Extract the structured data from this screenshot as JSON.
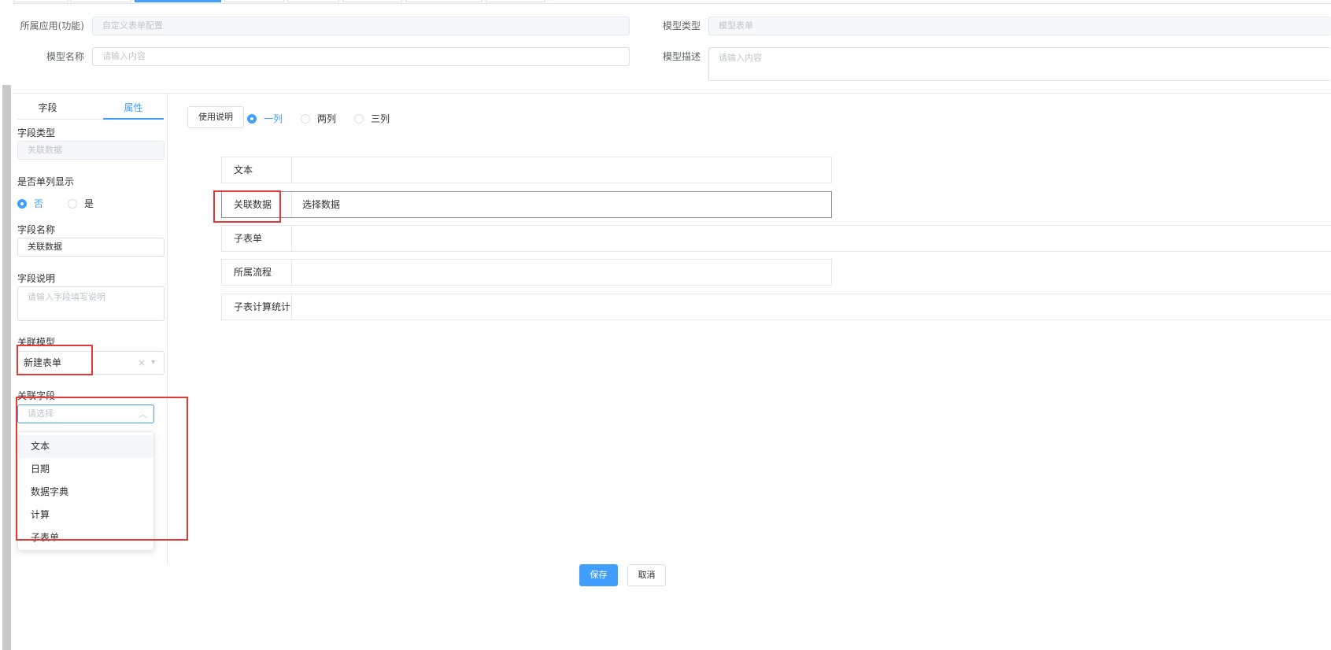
{
  "header": {
    "app_label": "所属应用(功能)",
    "app_value": "自定义表单配置",
    "type_label": "模型类型",
    "type_value": "模型表单",
    "name_label": "模型名称",
    "name_placeholder": "请输入内容",
    "desc_label": "模型描述",
    "desc_placeholder": "请输入内容"
  },
  "panel": {
    "tabs": [
      {
        "label": "字段",
        "active": false
      },
      {
        "label": "属性",
        "active": true
      }
    ],
    "field_type_label": "字段类型",
    "field_type_value": "关联数据",
    "single_col_label": "是否单列显示",
    "single_col_options": [
      {
        "label": "否",
        "checked": true
      },
      {
        "label": "是",
        "checked": false
      }
    ],
    "field_name_label": "字段名称",
    "field_name_value": "关联数据",
    "field_desc_label": "字段说明",
    "field_desc_placeholder": "请输入字段填写说明",
    "rel_model_label": "关联模型",
    "rel_model_value": "新建表单",
    "rel_field_label": "关联字段",
    "rel_field_placeholder": "请选择",
    "rel_field_options": [
      "文本",
      "日期",
      "数据字典",
      "计算",
      "子表单"
    ]
  },
  "canvas": {
    "usage_button": "使用说明",
    "columns": [
      {
        "label": "一列",
        "checked": true
      },
      {
        "label": "两列",
        "checked": false
      },
      {
        "label": "三列",
        "checked": false
      }
    ],
    "fields": [
      {
        "label": "文本",
        "value": ""
      },
      {
        "label": "关联数据",
        "value": "选择数据"
      },
      {
        "label": "子表单",
        "value": ""
      },
      {
        "label": "所属流程",
        "value": ""
      },
      {
        "label": "子表计算统计",
        "value": ""
      }
    ]
  },
  "footer": {
    "save": "保存",
    "cancel": "取消"
  },
  "colors": {
    "primary": "#409eff",
    "highlight_box": "#e53935"
  }
}
